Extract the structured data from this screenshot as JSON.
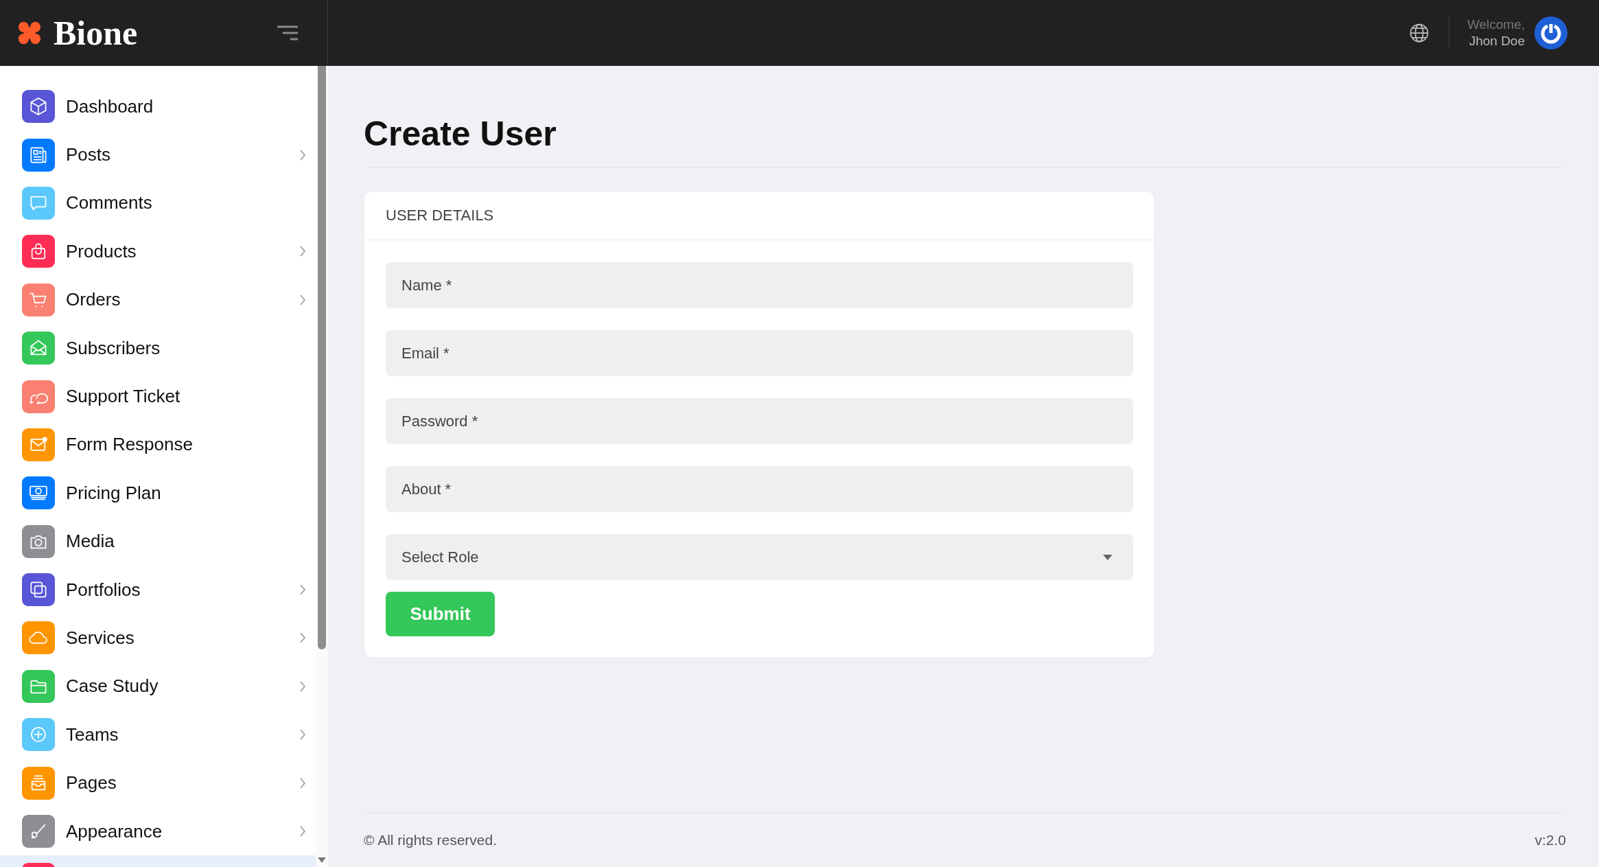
{
  "brand": {
    "name": "Bione"
  },
  "header": {
    "welcome": "Welcome,",
    "user_name": "Jhon Doe"
  },
  "sidebar": {
    "items": [
      {
        "label": "Dashboard",
        "has_submenu": false,
        "selected": false,
        "color": "#5856d6"
      },
      {
        "label": "Posts",
        "has_submenu": true,
        "selected": false,
        "color": "#007aff"
      },
      {
        "label": "Comments",
        "has_submenu": false,
        "selected": false,
        "color": "#5ac8fa"
      },
      {
        "label": "Products",
        "has_submenu": true,
        "selected": false,
        "color": "#ff2d55"
      },
      {
        "label": "Orders",
        "has_submenu": true,
        "selected": false,
        "color": "#fa8072"
      },
      {
        "label": "Subscribers",
        "has_submenu": false,
        "selected": false,
        "color": "#34c759"
      },
      {
        "label": "Support Ticket",
        "has_submenu": false,
        "selected": false,
        "color": "#fa8072"
      },
      {
        "label": "Form Response",
        "has_submenu": false,
        "selected": false,
        "color": "#ff9500"
      },
      {
        "label": "Pricing Plan",
        "has_submenu": false,
        "selected": false,
        "color": "#007aff"
      },
      {
        "label": "Media",
        "has_submenu": false,
        "selected": false,
        "color": "#8e8e93"
      },
      {
        "label": "Portfolios",
        "has_submenu": true,
        "selected": false,
        "color": "#5856d6"
      },
      {
        "label": "Services",
        "has_submenu": true,
        "selected": false,
        "color": "#ff9500"
      },
      {
        "label": "Case Study",
        "has_submenu": true,
        "selected": false,
        "color": "#34c759"
      },
      {
        "label": "Teams",
        "has_submenu": true,
        "selected": false,
        "color": "#5ac8fa"
      },
      {
        "label": "Pages",
        "has_submenu": true,
        "selected": false,
        "color": "#ff9500"
      },
      {
        "label": "Appearance",
        "has_submenu": true,
        "selected": false,
        "color": "#8e8e93"
      },
      {
        "has_submenu": false,
        "selected": true,
        "color": "#ff2d55"
      }
    ]
  },
  "page": {
    "title": "Create User"
  },
  "form": {
    "section_title": "USER DETAILS",
    "fields": [
      {
        "kind": "input",
        "placeholder": "Name *"
      },
      {
        "kind": "input",
        "placeholder": "Email *"
      },
      {
        "kind": "input",
        "placeholder": "Password *"
      },
      {
        "kind": "input",
        "placeholder": "About *"
      },
      {
        "kind": "select",
        "value": "Select Role"
      }
    ],
    "submit": "Submit"
  },
  "footer": {
    "copyright": "© All rights reserved.",
    "version": "v:2.0"
  }
}
